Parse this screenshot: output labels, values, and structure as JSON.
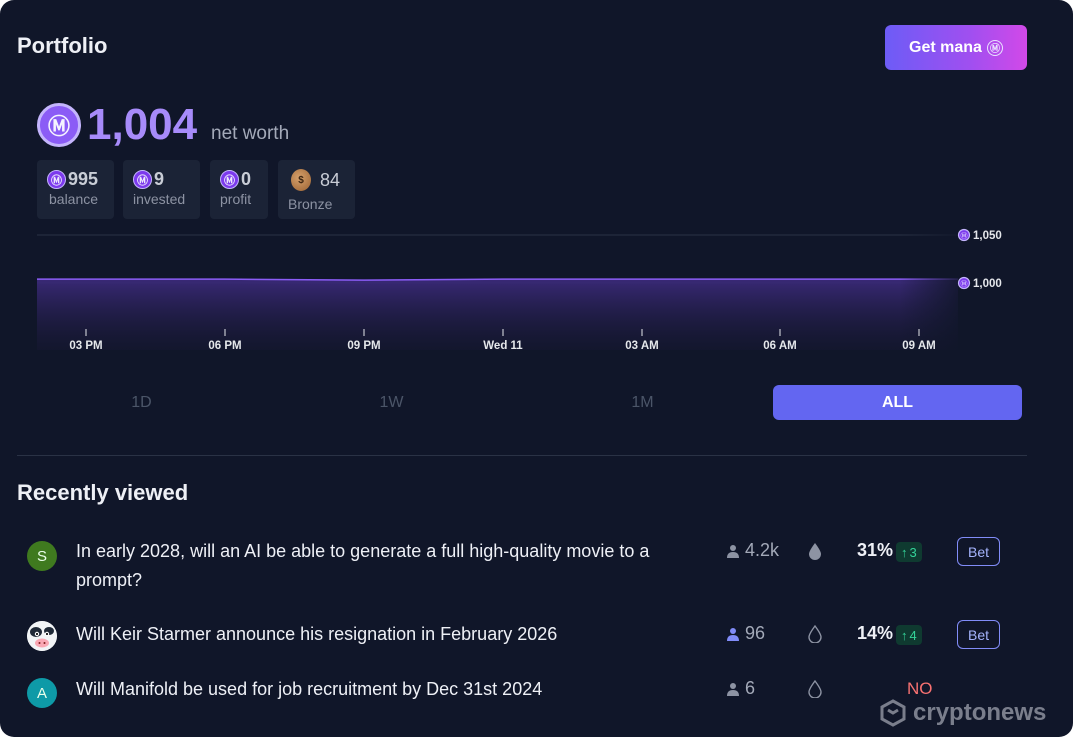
{
  "portfolio": {
    "title": "Portfolio",
    "get_mana_label": "Get mana",
    "currency_symbol": "Ⓜ",
    "net_worth_value": "1,004",
    "net_worth_label": "net worth",
    "stats": [
      {
        "value": "995",
        "label": "balance"
      },
      {
        "value": "9",
        "label": "invested"
      },
      {
        "value": "0",
        "label": "profit"
      },
      {
        "value": "84",
        "label": "Bronze"
      }
    ],
    "accent_color": "#a78bfa"
  },
  "chart_data": {
    "type": "area",
    "x": [
      "03 PM",
      "06 PM",
      "09 PM",
      "Wed 11",
      "03 AM",
      "06 AM",
      "09 AM"
    ],
    "series": [
      {
        "values": [
          1004,
          1004,
          1003,
          1004,
          1004,
          1004,
          1004
        ]
      }
    ],
    "y_ticks": [
      "1,050",
      "1,000"
    ],
    "ylim": [
      1000,
      1050
    ],
    "y_axis_side": "right",
    "grid": true
  },
  "time_tabs": {
    "options": [
      "1D",
      "1W",
      "1M",
      "ALL"
    ],
    "selected": "ALL"
  },
  "recently_viewed": {
    "title": "Recently viewed",
    "items": [
      {
        "avatar_letter": "S",
        "avatar_color": "#3f7a1f",
        "question": "In early 2028, will an AI be able to generate a full high-quality movie to a prompt?",
        "traders": "4.2k",
        "probability": "31%",
        "change": "3",
        "bet_label": "Bet"
      },
      {
        "avatar_letter": "",
        "avatar_icon": "cow-avatar-icon",
        "question": "Will Keir Starmer announce his resignation in February 2026",
        "traders": "96",
        "probability": "14%",
        "change": "4",
        "bet_label": "Bet"
      },
      {
        "avatar_letter": "A",
        "avatar_color": "#0e9aa7",
        "question": "Will Manifold be used for job recruitment by Dec 31st 2024",
        "traders": "6",
        "resolution": "NO"
      }
    ]
  },
  "watermark": {
    "text": "cryptonews"
  }
}
